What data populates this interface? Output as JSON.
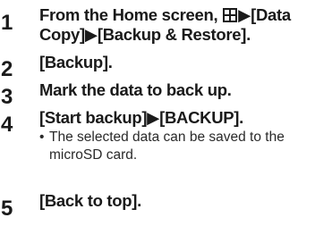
{
  "steps": [
    {
      "number": "1",
      "line1_pre": "From the Home screen, ",
      "icon": "apps-menu-icon",
      "line1_post": "▶[Data",
      "line2": "Copy]▶[Backup & Restore]."
    },
    {
      "number": "2",
      "text": "[Backup]."
    },
    {
      "number": "3",
      "text": "Mark the data to back up."
    },
    {
      "number": "4",
      "text": "[Start backup]▶[BACKUP].",
      "note_bullet": "•",
      "note_line1": "The selected data can be saved to the",
      "note_line2": "microSD card."
    },
    {
      "number": "5",
      "text": "[Back to top]."
    }
  ]
}
